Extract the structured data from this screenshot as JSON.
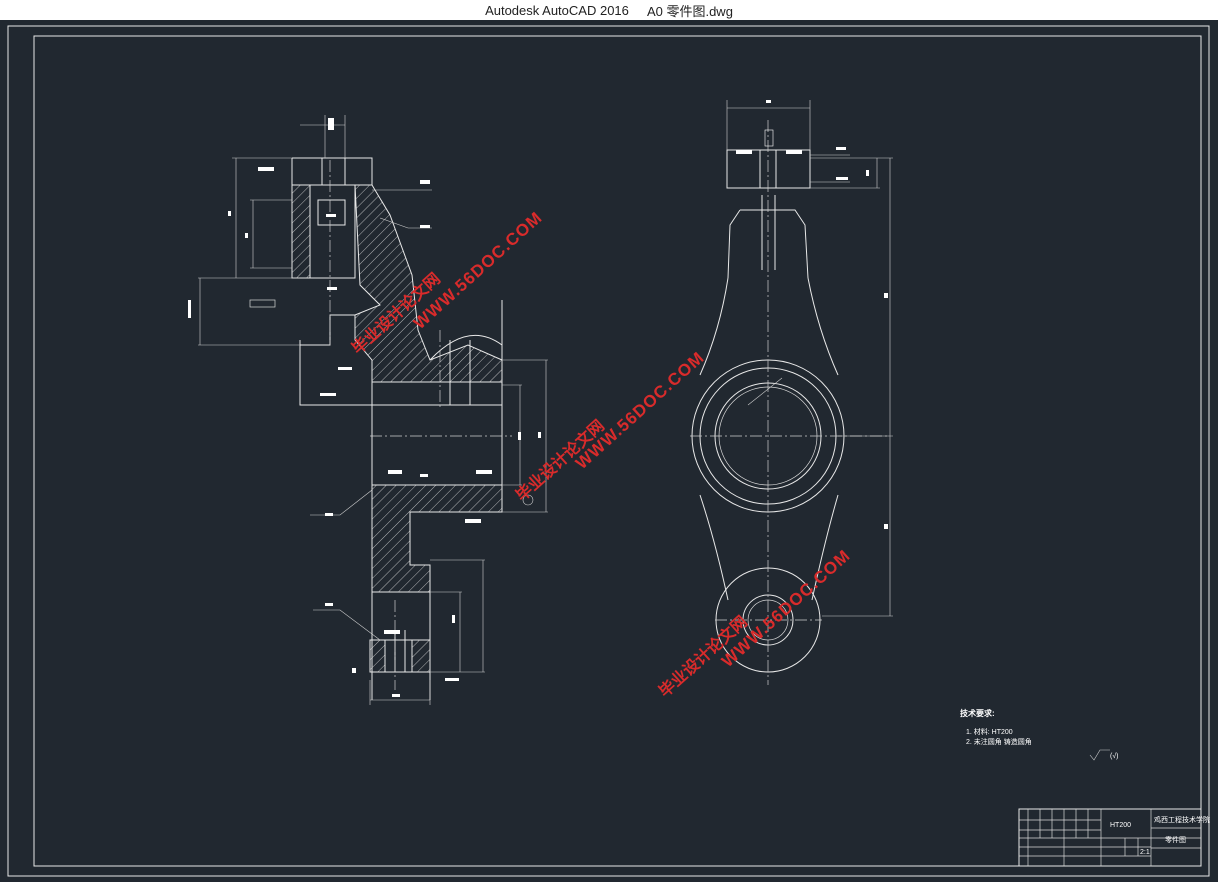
{
  "window": {
    "title_app": "Autodesk AutoCAD 2016",
    "title_file": "A0 零件图.dwg"
  },
  "watermark": {
    "url": "WWW.56DOC.COM",
    "cn": "毕业设计论文网"
  },
  "notes": {
    "heading": "技术要求:",
    "item1": "1. 材料: HT200",
    "item2": "2. 未注圆角 铸造圆角",
    "roughness": "(√)"
  },
  "title_block": {
    "material": "HT200",
    "school": "鸡西工程技术学院",
    "scale": "2:1",
    "part_name": "零件图"
  },
  "colors": {
    "background": "#212830",
    "lines": "#e8e8e8",
    "watermark": "#d92b2b"
  }
}
